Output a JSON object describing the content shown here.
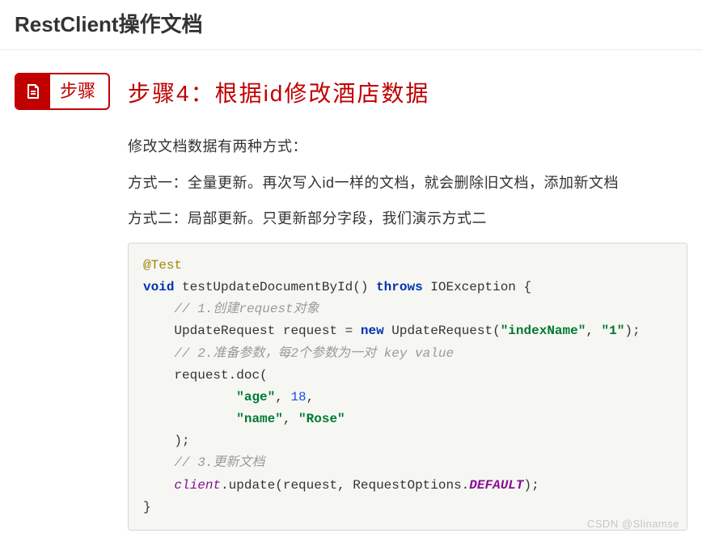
{
  "header": {
    "title": "RestClient操作文档"
  },
  "step_chip": {
    "label": "步骤"
  },
  "section": {
    "title": "步骤4：根据id修改酒店数据",
    "desc_intro": "修改文档数据有两种方式：",
    "desc_method1": "方式一：全量更新。再次写入id一样的文档，就会删除旧文档，添加新文档",
    "desc_method2": "方式二：局部更新。只更新部分字段，我们演示方式二"
  },
  "code": {
    "annotation": "@Test",
    "kw_void": "void",
    "method_name": " testUpdateDocumentById() ",
    "kw_throws": "throws",
    "throws_type": " IOException {",
    "comment1": "// 1.创建request对象",
    "line2_a": "UpdateRequest request = ",
    "kw_new": "new",
    "line2_b": " UpdateRequest(",
    "str_index": "\"indexName\"",
    "comma1": ", ",
    "str_id": "\"1\"",
    "line2_c": ");",
    "comment2": "// 2.准备参数，每2个参数为一对 key value",
    "line3": "request.doc(",
    "str_age": "\"age\"",
    "comma2": ", ",
    "num_18": "18",
    "comma3": ",",
    "str_name": "\"name\"",
    "comma4": ", ",
    "str_rose": "\"Rose\"",
    "line4": ");",
    "comment3": "// 3.更新文档",
    "field_client": "client",
    "line5_a": ".update(request, RequestOptions.",
    "const_default": "DEFAULT",
    "line5_b": ");",
    "close": "}"
  },
  "watermark": "CSDN @Slinamse"
}
